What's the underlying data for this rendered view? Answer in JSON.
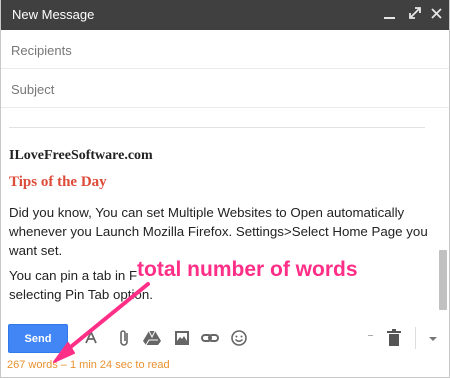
{
  "window": {
    "title": "New Message"
  },
  "fields": {
    "recipients_placeholder": "Recipients",
    "subject_placeholder": "Subject"
  },
  "body": {
    "site": "ILoveFreeSoftware.com",
    "heading": "Tips of the Day",
    "paragraph1": "Did you know, You can set Multiple Websites to Open automatically whenever you Launch Mozilla Firefox. Settings>Select Home Page you want set.",
    "paragraph2_start": "You can pin a tab in F",
    "paragraph2_end": "selecting Pin Tab option."
  },
  "toolbar": {
    "send_label": "Send",
    "icons": [
      "format-text-icon",
      "attach-icon",
      "drive-icon",
      "photo-icon",
      "link-icon",
      "emoji-icon",
      "more-options-icon",
      "trash-icon",
      "chevron-down-icon"
    ]
  },
  "status": {
    "word_count": "267 words – 1 min 24 sec to read"
  },
  "annotation": {
    "text": "total number of words",
    "color": "#ff2e87"
  },
  "colors": {
    "titlebar": "#404040",
    "send_button": "#4285f4",
    "heading": "#dd4b39",
    "word_count": "#e8912e"
  }
}
